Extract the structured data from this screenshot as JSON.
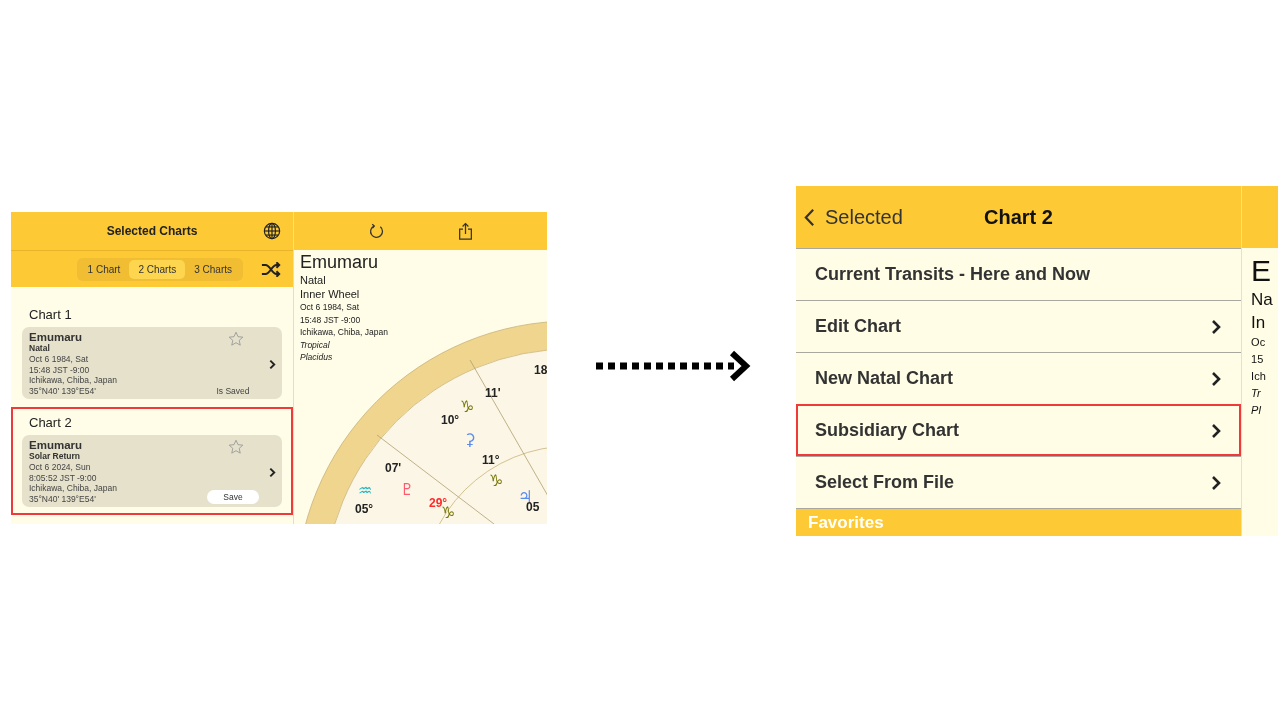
{
  "left_screen": {
    "sidebar": {
      "title": "Selected Charts",
      "segments": [
        {
          "label": "1 Chart",
          "selected": false
        },
        {
          "label": "2 Charts",
          "selected": true
        },
        {
          "label": "3 Charts",
          "selected": false
        }
      ],
      "sections": [
        {
          "heading": "Chart 1",
          "highlighted": false,
          "card": {
            "name": "Emumaru",
            "type": "Natal",
            "favorite": false,
            "lines": [
              "Oct 6 1984, Sat",
              "15:48 JST -9:00",
              "Ichikawa, Chiba, Japan",
              "35°N40' 139°E54'"
            ],
            "action": {
              "kind": "status",
              "label": "Is Saved"
            }
          }
        },
        {
          "heading": "Chart 2",
          "highlighted": true,
          "card": {
            "name": "Emumaru",
            "type": "Solar Return",
            "favorite": false,
            "lines": [
              "Oct 6 2024, Sun",
              "8:05:52 JST -9:00",
              "Ichikawa, Chiba, Japan",
              "35°N40' 139°E54'"
            ],
            "action": {
              "kind": "button",
              "label": "Save"
            }
          }
        }
      ]
    },
    "chart_view": {
      "name": "Emumaru",
      "lines": [
        "Natal",
        "Inner Wheel"
      ],
      "details": [
        "Oct 6 1984, Sat",
        "15:48 JST -9:00",
        "Ichikawa, Chiba, Japan"
      ],
      "settings": [
        "Tropical",
        "Placidus"
      ],
      "wheel_labels": [
        {
          "text": "18",
          "color": "#222222"
        },
        {
          "text": "11'",
          "color": "#222222"
        },
        {
          "text": "♑",
          "color": "#7a7a10"
        },
        {
          "text": "10°",
          "color": "#222222"
        },
        {
          "text": "⚳",
          "color": "#5b8def"
        },
        {
          "text": "11°",
          "color": "#222222"
        },
        {
          "text": "♑",
          "color": "#7a7a10"
        },
        {
          "text": "07'",
          "color": "#222222"
        },
        {
          "text": "♒",
          "color": "#1ab8c4"
        },
        {
          "text": "♇",
          "color": "#ff5a6e"
        },
        {
          "text": "29°",
          "color": "#ff2a2a"
        },
        {
          "text": "♑",
          "color": "#7a7a10"
        },
        {
          "text": "♃",
          "color": "#5b8def"
        },
        {
          "text": "05°",
          "color": "#222222"
        },
        {
          "text": "05",
          "color": "#222222"
        }
      ]
    }
  },
  "right_screen": {
    "back_label": "Selected",
    "title": "Chart 2",
    "menu": [
      {
        "label": "Current Transits - Here and Now",
        "has_chevron": false,
        "highlighted": false
      },
      {
        "label": "Edit Chart",
        "has_chevron": true,
        "highlighted": false
      },
      {
        "label": "New Natal Chart",
        "has_chevron": true,
        "highlighted": false
      },
      {
        "label": "Subsidiary Chart",
        "has_chevron": true,
        "highlighted": true
      },
      {
        "label": "Select From File",
        "has_chevron": true,
        "highlighted": false
      }
    ],
    "section_header": "Favorites",
    "side_strip": [
      "E",
      "Na",
      "In",
      "Oc",
      "15",
      "Ich",
      "Tr",
      "Pl"
    ]
  }
}
